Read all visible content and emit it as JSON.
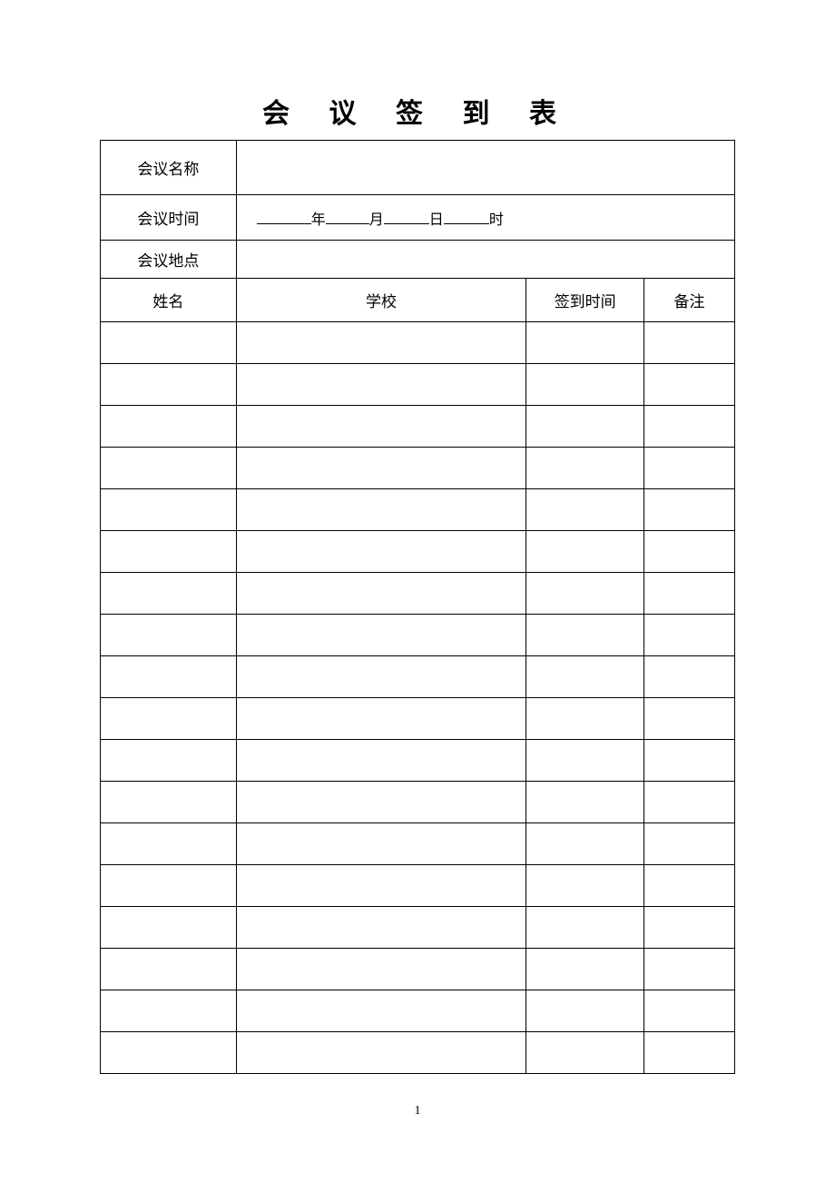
{
  "title": "会 议 签 到 表",
  "labels": {
    "meetingName": "会议名称",
    "meetingTime": "会议时间",
    "meetingLocation": "会议地点",
    "year": "年",
    "month": "月",
    "day": "日",
    "hour": "时"
  },
  "columns": {
    "name": "姓名",
    "school": "学校",
    "checkinTime": "签到时间",
    "remark": "备注"
  },
  "rows": [
    {
      "name": "",
      "school": "",
      "checkin": "",
      "remark": ""
    },
    {
      "name": "",
      "school": "",
      "checkin": "",
      "remark": ""
    },
    {
      "name": "",
      "school": "",
      "checkin": "",
      "remark": ""
    },
    {
      "name": "",
      "school": "",
      "checkin": "",
      "remark": ""
    },
    {
      "name": "",
      "school": "",
      "checkin": "",
      "remark": ""
    },
    {
      "name": "",
      "school": "",
      "checkin": "",
      "remark": ""
    },
    {
      "name": "",
      "school": "",
      "checkin": "",
      "remark": ""
    },
    {
      "name": "",
      "school": "",
      "checkin": "",
      "remark": ""
    },
    {
      "name": "",
      "school": "",
      "checkin": "",
      "remark": ""
    },
    {
      "name": "",
      "school": "",
      "checkin": "",
      "remark": ""
    },
    {
      "name": "",
      "school": "",
      "checkin": "",
      "remark": ""
    },
    {
      "name": "",
      "school": "",
      "checkin": "",
      "remark": ""
    },
    {
      "name": "",
      "school": "",
      "checkin": "",
      "remark": ""
    },
    {
      "name": "",
      "school": "",
      "checkin": "",
      "remark": ""
    },
    {
      "name": "",
      "school": "",
      "checkin": "",
      "remark": ""
    },
    {
      "name": "",
      "school": "",
      "checkin": "",
      "remark": ""
    },
    {
      "name": "",
      "school": "",
      "checkin": "",
      "remark": ""
    },
    {
      "name": "",
      "school": "",
      "checkin": "",
      "remark": ""
    }
  ],
  "pageNumber": "1"
}
